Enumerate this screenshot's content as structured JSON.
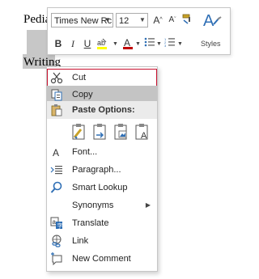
{
  "document": {
    "word_top": "Pedia",
    "word_bottom": "Writing"
  },
  "mini_toolbar": {
    "font_name": "Times New Rc",
    "font_size": "12",
    "bold": "B",
    "italic": "I",
    "underline": "U",
    "font_color_letter": "A",
    "styles_label": "Styles",
    "accent_color": "#c00000",
    "highlight_color": "#ffff00"
  },
  "context_menu": {
    "cut": "Cut",
    "copy": "Copy",
    "paste_options": "Paste Options:",
    "font": "Font...",
    "paragraph": "Paragraph...",
    "smart_lookup": "Smart Lookup",
    "synonyms": "Synonyms",
    "translate": "Translate",
    "link": "Link",
    "new_comment": "New Comment",
    "highlight_outline_color": "#c8102e"
  }
}
